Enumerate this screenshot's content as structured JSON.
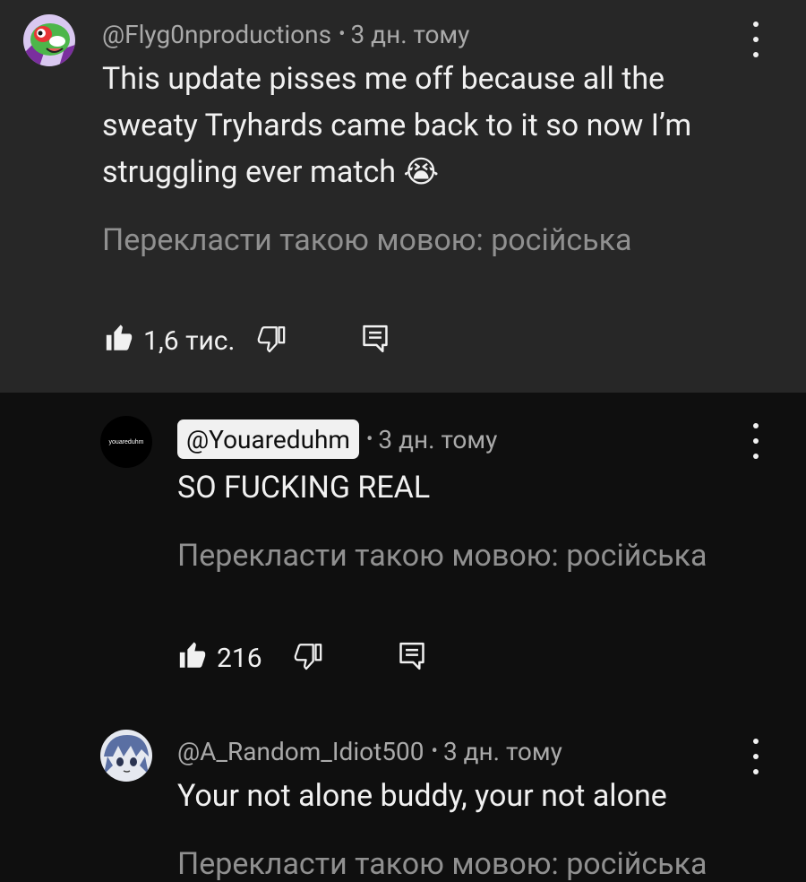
{
  "comments": [
    {
      "author": "@Flyg0nproductions",
      "time": "3 дн. тому",
      "text": "This update pisses me off because all the sweaty Tryhards came back to it so now I’m struggling ever match 😭",
      "translate": "Перекласти такою мовою: російська",
      "likes": "1,6 тис."
    },
    {
      "author": "@Youareduhm",
      "avatar_text": "youareduhm",
      "time": "3 дн. тому",
      "text": "SO FUCKING REAL",
      "translate": "Перекласти такою мовою: російська",
      "likes": "216"
    },
    {
      "author": "@A_Random_Idiot500",
      "time": "3 дн. тому",
      "text": "Your not alone buddy, your not alone",
      "translate": "Перекласти такою мовою: російська"
    }
  ],
  "meta_separator": "•",
  "icons": {
    "like": "thumb-up-icon",
    "dislike": "thumb-down-icon",
    "reply": "reply-comment-icon",
    "more": "more-vert-icon"
  },
  "colors": {
    "main_background": "#272727",
    "reply_background": "#0f0f0f",
    "text_primary": "#f1f1f1",
    "text_secondary": "#aaaaaa",
    "author_chip": "#f1f1f1"
  }
}
